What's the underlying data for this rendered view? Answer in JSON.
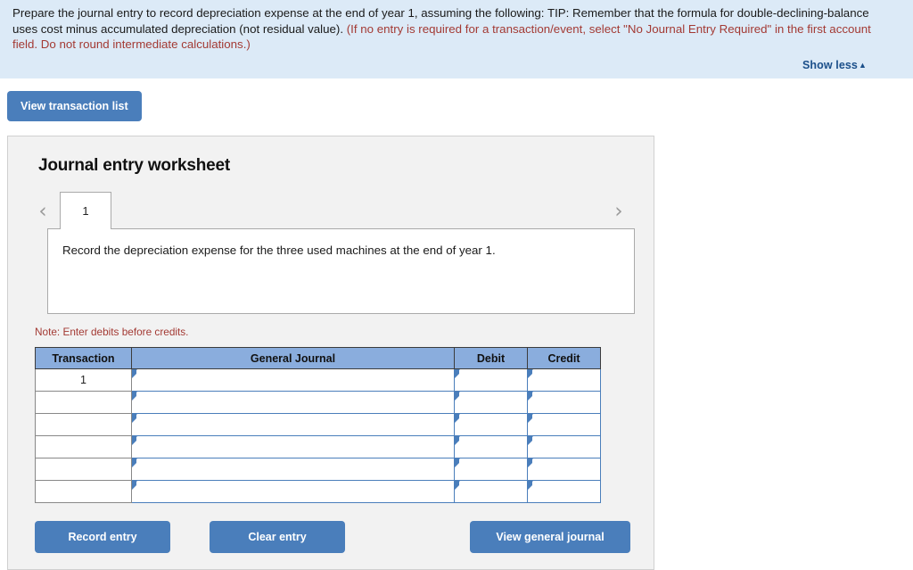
{
  "banner": {
    "text_part1": "Prepare the journal entry to record depreciation expense at the end of year 1, assuming the following: TIP: Remember that the formula for double-declining-balance uses cost minus accumulated depreciation (not residual value). ",
    "text_part2": "(If no entry is required for a transaction/event, select \"No Journal Entry Required\" in the first account field. Do not round intermediate calculations.)",
    "show_less_label": "Show less",
    "show_less_caret": "▲",
    "background_color": "#dceaf7",
    "note_color": "#a33a34",
    "link_color": "#1b4f8a"
  },
  "toolbar": {
    "view_transaction_list_label": "View transaction list"
  },
  "worksheet": {
    "title": "Journal entry worksheet",
    "prev_arrow": "‹",
    "next_arrow": "›",
    "tabs": [
      {
        "label": "1",
        "active": true
      }
    ],
    "description": "Record the depreciation expense for the three used machines at the end of year 1.",
    "note": "Note: Enter debits before credits.",
    "accent_color": "#4a7ebb",
    "header_color": "#8aaddd"
  },
  "table": {
    "columns": [
      {
        "key": "transaction",
        "label": "Transaction"
      },
      {
        "key": "general_journal",
        "label": "General Journal"
      },
      {
        "key": "debit",
        "label": "Debit"
      },
      {
        "key": "credit",
        "label": "Credit"
      }
    ],
    "rows": [
      {
        "transaction": "1",
        "general_journal": "",
        "debit": "",
        "credit": ""
      },
      {
        "transaction": "",
        "general_journal": "",
        "debit": "",
        "credit": ""
      },
      {
        "transaction": "",
        "general_journal": "",
        "debit": "",
        "credit": ""
      },
      {
        "transaction": "",
        "general_journal": "",
        "debit": "",
        "credit": ""
      },
      {
        "transaction": "",
        "general_journal": "",
        "debit": "",
        "credit": ""
      },
      {
        "transaction": "",
        "general_journal": "",
        "debit": "",
        "credit": ""
      }
    ]
  },
  "footer": {
    "record_entry_label": "Record entry",
    "clear_entry_label": "Clear entry",
    "view_general_journal_label": "View general journal"
  }
}
